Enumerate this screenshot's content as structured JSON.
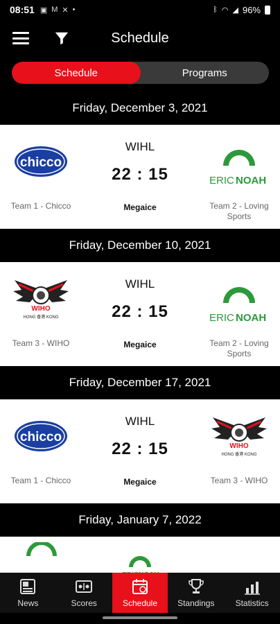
{
  "status": {
    "time": "08:51",
    "battery": "96%",
    "notif_icons": [
      "photo-icon",
      "gmail-icon",
      "x-icon",
      "dot-icon"
    ]
  },
  "appbar": {
    "title": "Schedule"
  },
  "segments": [
    {
      "label": "Schedule",
      "active": true
    },
    {
      "label": "Programs",
      "active": false
    }
  ],
  "games": [
    {
      "date": "Friday, December 3, 2021",
      "league": "WIHL",
      "time": "22 : 15",
      "venue": "Megaice",
      "team1": {
        "name": "Team 1 - Chicco",
        "logo": "chicco-logo"
      },
      "team2": {
        "name": "Team 2 - Loving Sports",
        "logo": "ericnoah-logo"
      }
    },
    {
      "date": "Friday, December 10, 2021",
      "league": "WIHL",
      "time": "22 : 15",
      "venue": "Megaice",
      "team1": {
        "name": "Team 3 - WIHO",
        "logo": "wiho-logo"
      },
      "team2": {
        "name": "Team 2 - Loving Sports",
        "logo": "ericnoah-logo"
      }
    },
    {
      "date": "Friday, December 17, 2021",
      "league": "WIHL",
      "time": "22 : 15",
      "venue": "Megaice",
      "team1": {
        "name": "Team 1 - Chicco",
        "logo": "chicco-logo"
      },
      "team2": {
        "name": "Team 3 - WIHO",
        "logo": "wiho-logo"
      }
    },
    {
      "date": "Friday, January 7, 2022"
    }
  ],
  "logo_text": {
    "chicco": "chicco",
    "eric": "ERIC",
    "noah": "NOAH",
    "wiho": "WIHO",
    "wiho_sub": "HONG 香港 KONG"
  },
  "bottom_nav": [
    {
      "label": "News",
      "icon": "news-icon",
      "active": false
    },
    {
      "label": "Scores",
      "icon": "scores-icon",
      "active": false
    },
    {
      "label": "Schedule",
      "icon": "schedule-icon",
      "active": true
    },
    {
      "label": "Standings",
      "icon": "trophy-icon",
      "active": false
    },
    {
      "label": "Statistics",
      "icon": "statistics-icon",
      "active": false
    }
  ],
  "colors": {
    "accent": "#e8101a",
    "chicco_blue": "#1a3fa0",
    "ericnoah_green": "#2c9a3a",
    "background": "#000000"
  }
}
